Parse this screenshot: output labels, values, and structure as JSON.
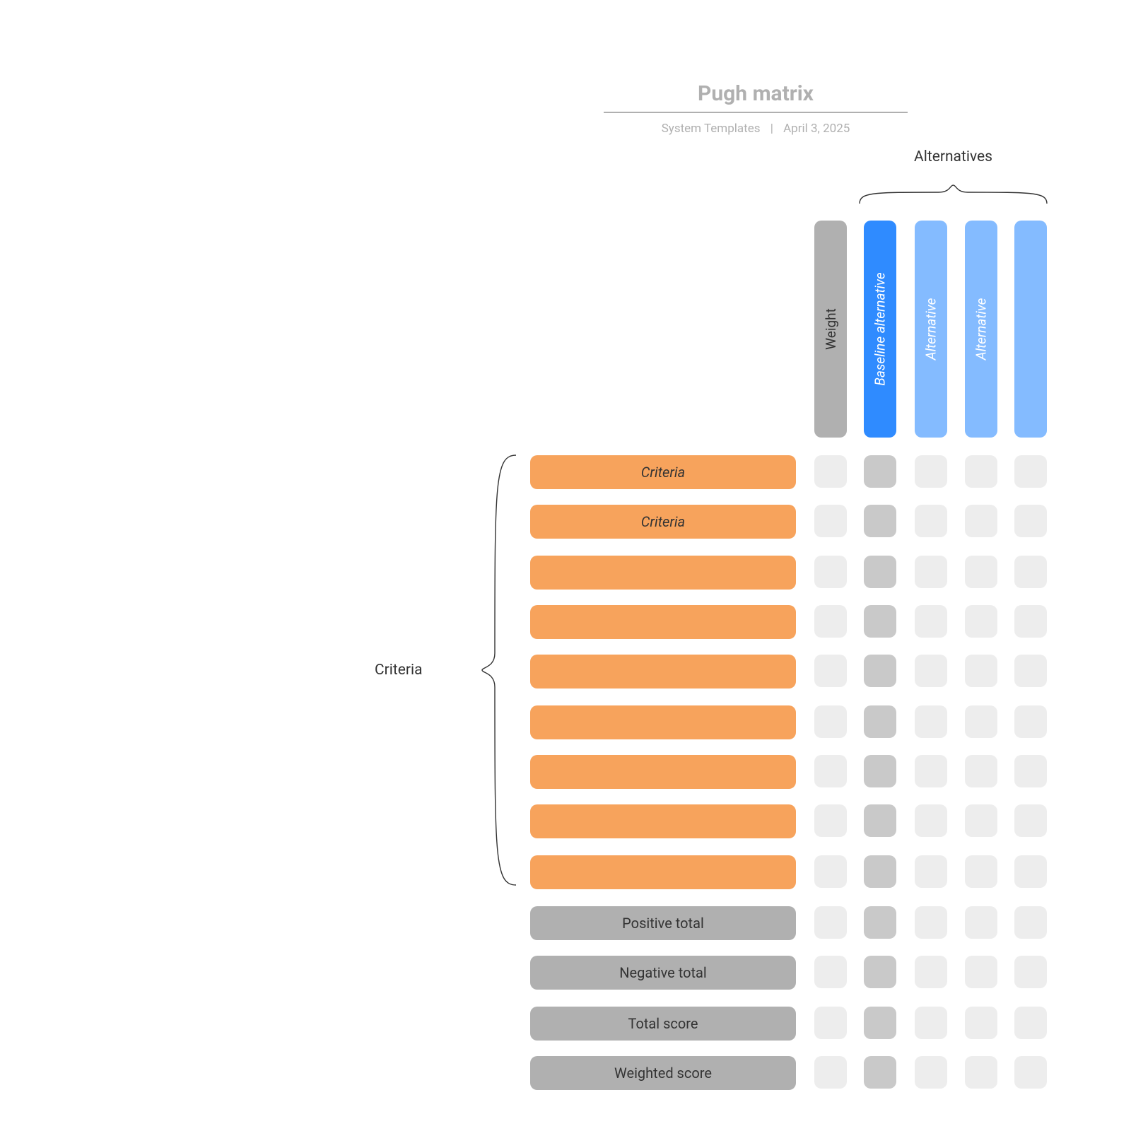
{
  "header": {
    "title": "Pugh matrix",
    "source": "System Templates",
    "date": "April 3, 2025"
  },
  "columns": {
    "weight_label": "Weight",
    "alternatives_group_label": "Alternatives",
    "alternatives": [
      {
        "label": "Baseline alternative",
        "is_baseline": true
      },
      {
        "label": "Alternative",
        "is_baseline": false
      },
      {
        "label": "Alternative",
        "is_baseline": false
      },
      {
        "label": "",
        "is_baseline": false
      }
    ]
  },
  "criteria_group_label": "Criteria",
  "criteria_rows": [
    {
      "label": "Criteria"
    },
    {
      "label": "Criteria"
    },
    {
      "label": ""
    },
    {
      "label": ""
    },
    {
      "label": ""
    },
    {
      "label": ""
    },
    {
      "label": ""
    },
    {
      "label": ""
    },
    {
      "label": ""
    }
  ],
  "totals_rows": [
    {
      "label": "Positive total"
    },
    {
      "label": "Negative total"
    },
    {
      "label": "Total score"
    },
    {
      "label": "Weighted score"
    }
  ],
  "colors": {
    "criteria_fill": "#f7a35c",
    "totals_fill": "#b0b0b0",
    "weight_col": "#b0b0b0",
    "baseline_col": "#2f8bff",
    "alt_col": "#84bbff",
    "cell_light": "#ededed",
    "cell_dark": "#c9c9c9"
  }
}
